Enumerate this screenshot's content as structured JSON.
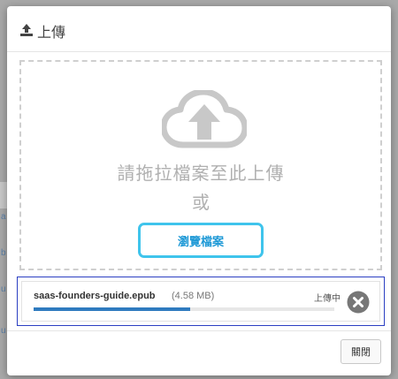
{
  "modal": {
    "title": "上傳",
    "drop_text": "請拖拉檔案至此上傳",
    "or_text": "或",
    "browse_label": "瀏覽檔案",
    "close_label": "關閉"
  },
  "upload": {
    "file_name": "saas-founders-guide.epub",
    "file_size": "(4.58 MB)",
    "status": "上傳中",
    "progress_percent": 52
  },
  "colors": {
    "accent": "#3fc4ec",
    "progress": "#2f7bbf",
    "focus_outline": "#2b3fc2"
  },
  "background": {
    "row_chars": [
      "a",
      "b",
      "u",
      "u"
    ]
  }
}
